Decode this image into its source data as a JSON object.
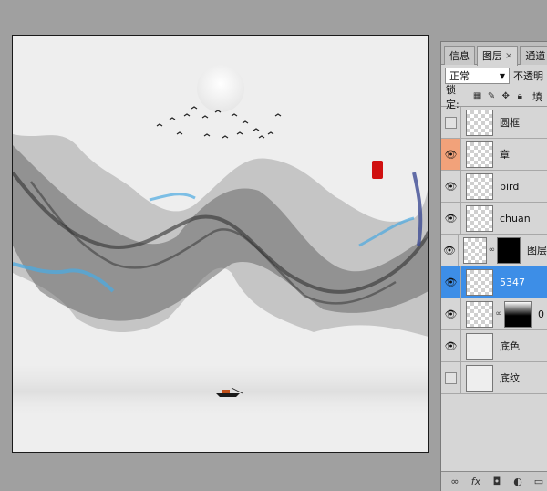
{
  "panel": {
    "tabs": [
      {
        "label": "信息"
      },
      {
        "label": "图层",
        "close": "×"
      },
      {
        "label": "通道"
      }
    ],
    "blend_mode": "正常",
    "opacity_label": "不透明",
    "lock_label": "锁定:",
    "fill_label": "填",
    "layers": [
      {
        "name": "圆框",
        "visible": false
      },
      {
        "name": "章",
        "visible": true
      },
      {
        "name": "bird",
        "visible": true
      },
      {
        "name": "chuan",
        "visible": true
      },
      {
        "name": "图层",
        "visible": true
      },
      {
        "name": "5347",
        "visible": true,
        "selected": true
      },
      {
        "name": "0",
        "visible": true
      },
      {
        "name": "底色",
        "visible": true
      },
      {
        "name": "底纹",
        "visible": false
      }
    ],
    "bottom_icons": [
      "link-icon",
      "fx-icon",
      "mask-icon",
      "adjustment-icon",
      "folder-icon"
    ]
  },
  "colors": {
    "selection": "#3d8ee7",
    "highlight": "#f2a27a",
    "seal_red": "#d01010",
    "water_blue": "#3aa3e0"
  }
}
